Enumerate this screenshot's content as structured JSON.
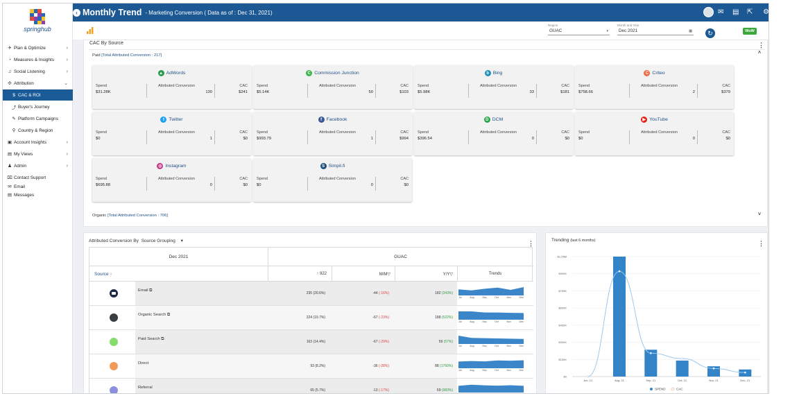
{
  "app": {
    "logo_text": "springhub"
  },
  "header": {
    "title": "Monthly Trend",
    "subtitle": "- Marketing Conversion ( Data as of : Dec 31, 2021)"
  },
  "sidebar": {
    "items": [
      {
        "label": "Plan & Optimize",
        "icon": "rocket-icon",
        "chevron": "›"
      },
      {
        "label": "Measures & Insights",
        "icon": "gauge-icon",
        "chevron": "›"
      },
      {
        "label": "Social Listening",
        "icon": "headset-icon",
        "chevron": "›"
      },
      {
        "label": "Attribution",
        "icon": "target-icon",
        "chevron": "⌄"
      },
      {
        "label": "CAC & ROI",
        "icon": "dollar-icon"
      },
      {
        "label": "Buyer's Journey",
        "icon": "journey-icon"
      },
      {
        "label": "Platform Campaigns",
        "icon": "campaign-icon"
      },
      {
        "label": "Country & Region",
        "icon": "pin-icon"
      },
      {
        "label": "Account Insights",
        "icon": "briefcase-icon",
        "chevron": "›"
      },
      {
        "label": "My Views",
        "icon": "views-icon",
        "chevron": "›"
      },
      {
        "label": "Admin",
        "icon": "user-icon",
        "chevron": "›"
      },
      {
        "label": "Contact Support",
        "icon": "support-icon"
      },
      {
        "label": "Email",
        "icon": "envelope-icon"
      },
      {
        "label": "Messages",
        "icon": "chat-icon"
      }
    ]
  },
  "filters": {
    "region_label": "Region",
    "region_value": "GUAC",
    "month_label": "Month and Year",
    "month_value": "Dec 2021",
    "badge": "WoW"
  },
  "cac": {
    "title": "CAC By Source",
    "paid_label": "Paid",
    "paid_total": "[Total Attributed Conversion : 217]",
    "organic_label": "Organic",
    "organic_total": "[Total Attributed Conversion : 706]",
    "spend_label": "Spend",
    "conv_label": "Attributed Conversion",
    "cac_label": "CAC",
    "cards": [
      {
        "name": "AdWords",
        "spend": "$31.28K",
        "conv": "130",
        "cac": "$241",
        "color": "#2a9d4c",
        "glyph": "▲"
      },
      {
        "name": "Commission Junction",
        "spend": "$5.14K",
        "conv": "50",
        "cac": "$103",
        "color": "#3bb54a",
        "glyph": "C"
      },
      {
        "name": "Bing",
        "spend": "$5.98K",
        "conv": "33",
        "cac": "$181",
        "color": "#1f8fb8",
        "glyph": "b"
      },
      {
        "name": "Criteo",
        "spend": "$758.66",
        "conv": "2",
        "cac": "$379",
        "color": "#f06a45",
        "glyph": "C"
      },
      {
        "name": "Twitter",
        "spend": "$0",
        "conv": "1",
        "cac": "$0",
        "color": "#1da1f2",
        "glyph": "t"
      },
      {
        "name": "Facebook",
        "spend": "$993.79",
        "conv": "1",
        "cac": "$994",
        "color": "#3b5998",
        "glyph": "f"
      },
      {
        "name": "DCM",
        "spend": "$396.54",
        "conv": "0",
        "cac": "$0",
        "color": "#27a34b",
        "glyph": "D"
      },
      {
        "name": "YouTube",
        "spend": "$0",
        "conv": "0",
        "cac": "$0",
        "color": "#e62117",
        "glyph": "▶"
      },
      {
        "name": "Instagram",
        "spend": "$695.88",
        "conv": "0",
        "cac": "$0",
        "color": "#c13584",
        "glyph": "◎"
      },
      {
        "name": "Simpli.fi",
        "spend": "$0",
        "conv": "0",
        "cac": "$0",
        "color": "#1a4f7a",
        "glyph": "S"
      }
    ]
  },
  "attribution": {
    "title": "Attributed Conversion By",
    "grouping": "Source Grouping",
    "period": "Dec 2021",
    "region": "GUAC",
    "col_source": "Source ↑",
    "col_total": "↑ 922",
    "col_mm": "M/M▽",
    "col_yy": "Y/Y▽",
    "col_trends": "Trends",
    "months": [
      "Jul",
      "Aug",
      "Sep",
      "Oct",
      "Nov",
      "Dec"
    ],
    "rows": [
      {
        "name": "Email ⧉",
        "dot": "#1b2b46",
        "total": "235",
        "total_pct": "(20.6%)",
        "mm": "-44",
        "mm_pct": "(-16%)",
        "yy": "182",
        "yy_pct": "(343%)",
        "trend": [
          0.55,
          0.45,
          0.6,
          0.7,
          0.5,
          0.75
        ]
      },
      {
        "name": "Organic Search ⧉",
        "dot": "#3a3d42",
        "total": "224",
        "total_pct": "(19.7%)",
        "mm": "-67",
        "mm_pct": "(-23%)",
        "yy": "188",
        "yy_pct": "(522%)",
        "trend": [
          0.75,
          0.75,
          0.65,
          0.65,
          0.62,
          0.6
        ]
      },
      {
        "name": "Paid Search ⧉",
        "dot": "#86dc6a",
        "total": "163",
        "total_pct": "(14.4%)",
        "mm": "-67",
        "mm_pct": "(-29%)",
        "yy": "59",
        "yy_pct": "(57%)",
        "trend": [
          0.75,
          0.55,
          0.52,
          0.5,
          0.48,
          0.45
        ]
      },
      {
        "name": "Direct",
        "dot": "#f19a5a",
        "total": "93",
        "total_pct": "(8.2%)",
        "mm": "-36",
        "mm_pct": "(-28%)",
        "yy": "88",
        "yy_pct": "(1760%)",
        "trend": [
          0.6,
          0.65,
          0.62,
          0.7,
          0.68,
          0.72
        ]
      },
      {
        "name": "Referral",
        "dot": "#8b8fde",
        "total": "65",
        "total_pct": "(5.7%)",
        "mm": "-13",
        "mm_pct": "(-17%)",
        "yy": "59",
        "yy_pct": "(983%)",
        "trend": [
          0.6,
          0.7,
          0.65,
          0.62,
          0.66,
          0.6
        ]
      }
    ]
  },
  "trending": {
    "title": "Trending",
    "subtitle": "(last 6 months)"
  },
  "chart_data": {
    "type": "bar",
    "categories": [
      "Jun, 21",
      "Aug, 21",
      "Sep, 21",
      "Oct, 21",
      "Nov, 21",
      "Dec, 21"
    ],
    "series": [
      {
        "name": "SPEND",
        "type": "bar",
        "values": [
          0,
          1050000,
          235000,
          140000,
          90000,
          62000
        ],
        "color": "#3383c8"
      },
      {
        "name": "CAC",
        "type": "line",
        "values": [
          0,
          1170,
          260,
          200,
          90,
          45
        ],
        "color": "#9cc8ec"
      }
    ],
    "yticks": [
      "$1.05M",
      "$900K",
      "$750K",
      "$600K",
      "$450K",
      "$300K",
      "$150K",
      "$0"
    ],
    "ylim": [
      0,
      1050000
    ],
    "legend": "bottom-center"
  }
}
